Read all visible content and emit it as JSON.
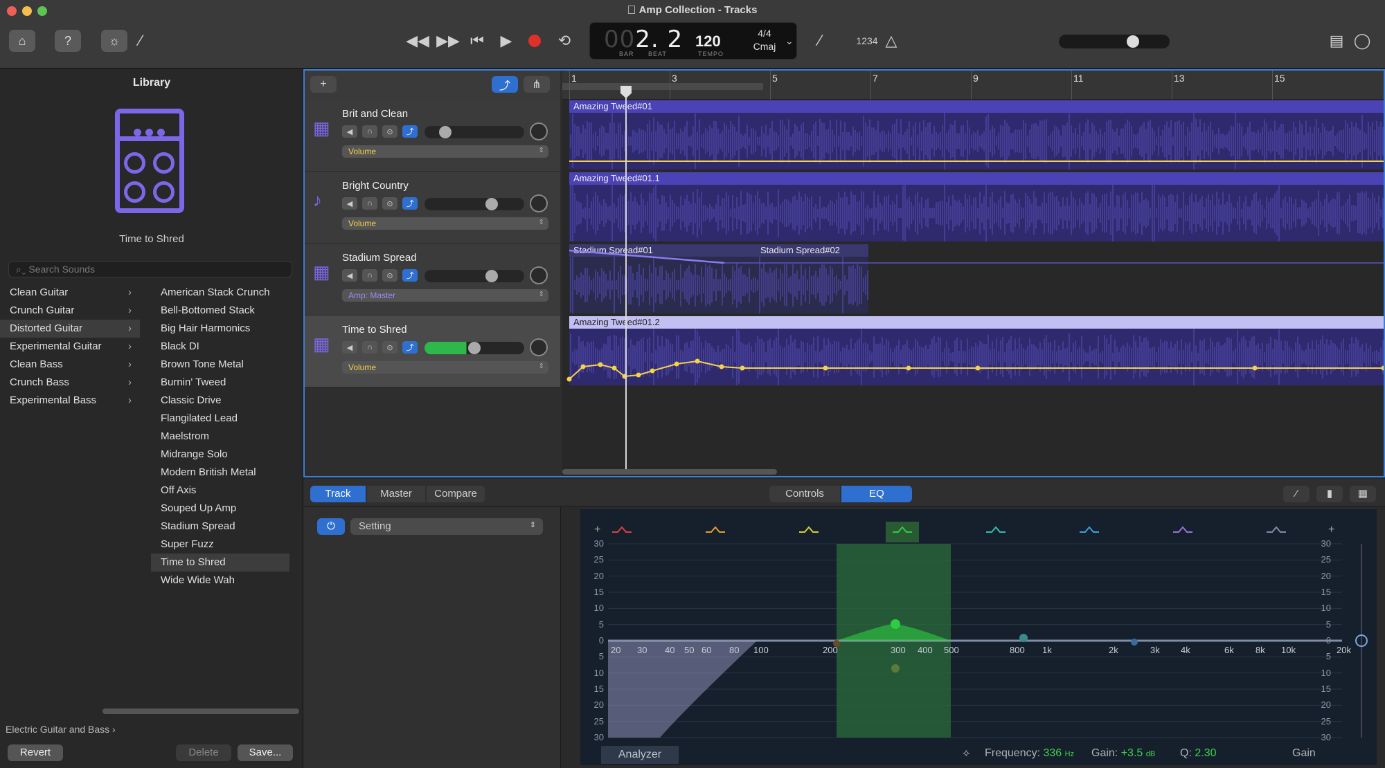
{
  "window": {
    "title": "Amp Collection - Tracks"
  },
  "toolbar": {
    "lcd": {
      "bar_dim": "00",
      "bar": "2. 2",
      "bar_label": "BAR",
      "beat_label": "BEAT",
      "tempo": "120",
      "tempo_label": "TEMPO",
      "sig": "4/4",
      "key": "Cmaj"
    },
    "count_in": "1234"
  },
  "library": {
    "title": "Library",
    "preset_name": "Time to Shred",
    "search_placeholder": "Search Sounds",
    "categories": [
      {
        "label": "Clean Guitar"
      },
      {
        "label": "Crunch Guitar"
      },
      {
        "label": "Distorted Guitar"
      },
      {
        "label": "Experimental Guitar"
      },
      {
        "label": "Clean Bass"
      },
      {
        "label": "Crunch Bass"
      },
      {
        "label": "Experimental Bass"
      }
    ],
    "selected_category": "Distorted Guitar",
    "presets": [
      {
        "label": "American Stack Crunch"
      },
      {
        "label": "Bell-Bottomed Stack"
      },
      {
        "label": "Big Hair Harmonics"
      },
      {
        "label": "Black DI"
      },
      {
        "label": "Brown Tone Metal"
      },
      {
        "label": "Burnin' Tweed"
      },
      {
        "label": "Classic Drive"
      },
      {
        "label": "Flangilated Lead"
      },
      {
        "label": "Maelstrom"
      },
      {
        "label": "Midrange Solo"
      },
      {
        "label": "Modern British Metal"
      },
      {
        "label": "Off Axis"
      },
      {
        "label": "Souped Up Amp"
      },
      {
        "label": "Stadium Spread"
      },
      {
        "label": "Super Fuzz"
      },
      {
        "label": "Time to Shred"
      },
      {
        "label": "Wide Wide Wah"
      }
    ],
    "selected_preset": "Time to Shred",
    "footer_path": "Electric Guitar and Bass ›",
    "revert": "Revert",
    "delete": "Delete",
    "save": "Save..."
  },
  "tracks": {
    "ruler": [
      "1",
      "3",
      "5",
      "7",
      "9",
      "11",
      "13",
      "15"
    ],
    "items": [
      {
        "name": "Brit and Clean",
        "menu": "Volume",
        "fader": 0.17,
        "regions": [
          {
            "label": "Amazing Tweed#01"
          }
        ]
      },
      {
        "name": "Bright Country",
        "menu": "Volume",
        "fader": 0.7,
        "regions": [
          {
            "label": "Amazing Tweed#01.1"
          }
        ]
      },
      {
        "name": "Stadium Spread",
        "menu": "Amp: Master",
        "fader": 0.7,
        "regions": [
          {
            "label": "Stadium Spread#01"
          },
          {
            "label": "Stadium Spread#02"
          }
        ]
      },
      {
        "name": "Time to Shred",
        "menu": "Volume",
        "fader": 0.5,
        "regions": [
          {
            "label": "Amazing Tweed#01.2"
          }
        ]
      }
    ]
  },
  "smart_controls": {
    "tabs": [
      "Track",
      "Master",
      "Compare"
    ],
    "view_tabs": [
      "Controls",
      "EQ"
    ],
    "active_view": "EQ",
    "setting": "Setting",
    "eq": {
      "db_ticks": [
        "30",
        "25",
        "20",
        "15",
        "10",
        "5",
        "0",
        "5",
        "10",
        "15",
        "20",
        "25",
        "30"
      ],
      "freq_ticks": [
        "20",
        "30",
        "40",
        "50",
        "60",
        "80",
        "100",
        "200",
        "300",
        "400",
        "500",
        "800",
        "1k",
        "2k",
        "3k",
        "4k",
        "6k",
        "8k",
        "10k",
        "20k"
      ],
      "analyzer": "Analyzer",
      "frequency_label": "Frequency:",
      "frequency_value": "336",
      "frequency_unit": "Hz",
      "gain_label": "Gain:",
      "gain_value": "+3.5",
      "gain_unit": "dB",
      "q_label": "Q:",
      "q_value": "2.30",
      "gain_knob_label": "Gain"
    }
  },
  "colors": {
    "accent": "#2e6fd0",
    "region": "#4b43b5",
    "amp": "#7b67e8",
    "eq_band": "#2ecc40"
  }
}
